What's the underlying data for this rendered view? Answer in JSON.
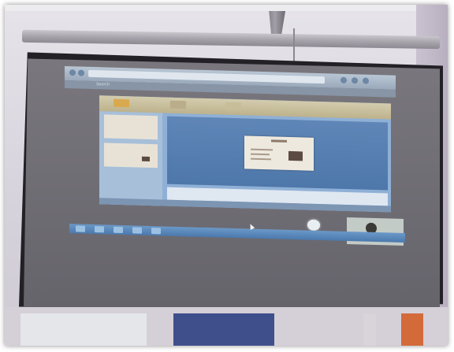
{
  "photo": {
    "subject": "",
    "projected_ui": {
      "browser_tab_label": "Search",
      "browser_right_label": "",
      "taskbar_clock": ""
    }
  },
  "colors": {
    "screen": "#6f6d74",
    "browser_bar": "#9aa9bb",
    "ppt_background": "#8fb0d6",
    "taskbar": "#4b79ad",
    "slide": "#eee9df"
  }
}
